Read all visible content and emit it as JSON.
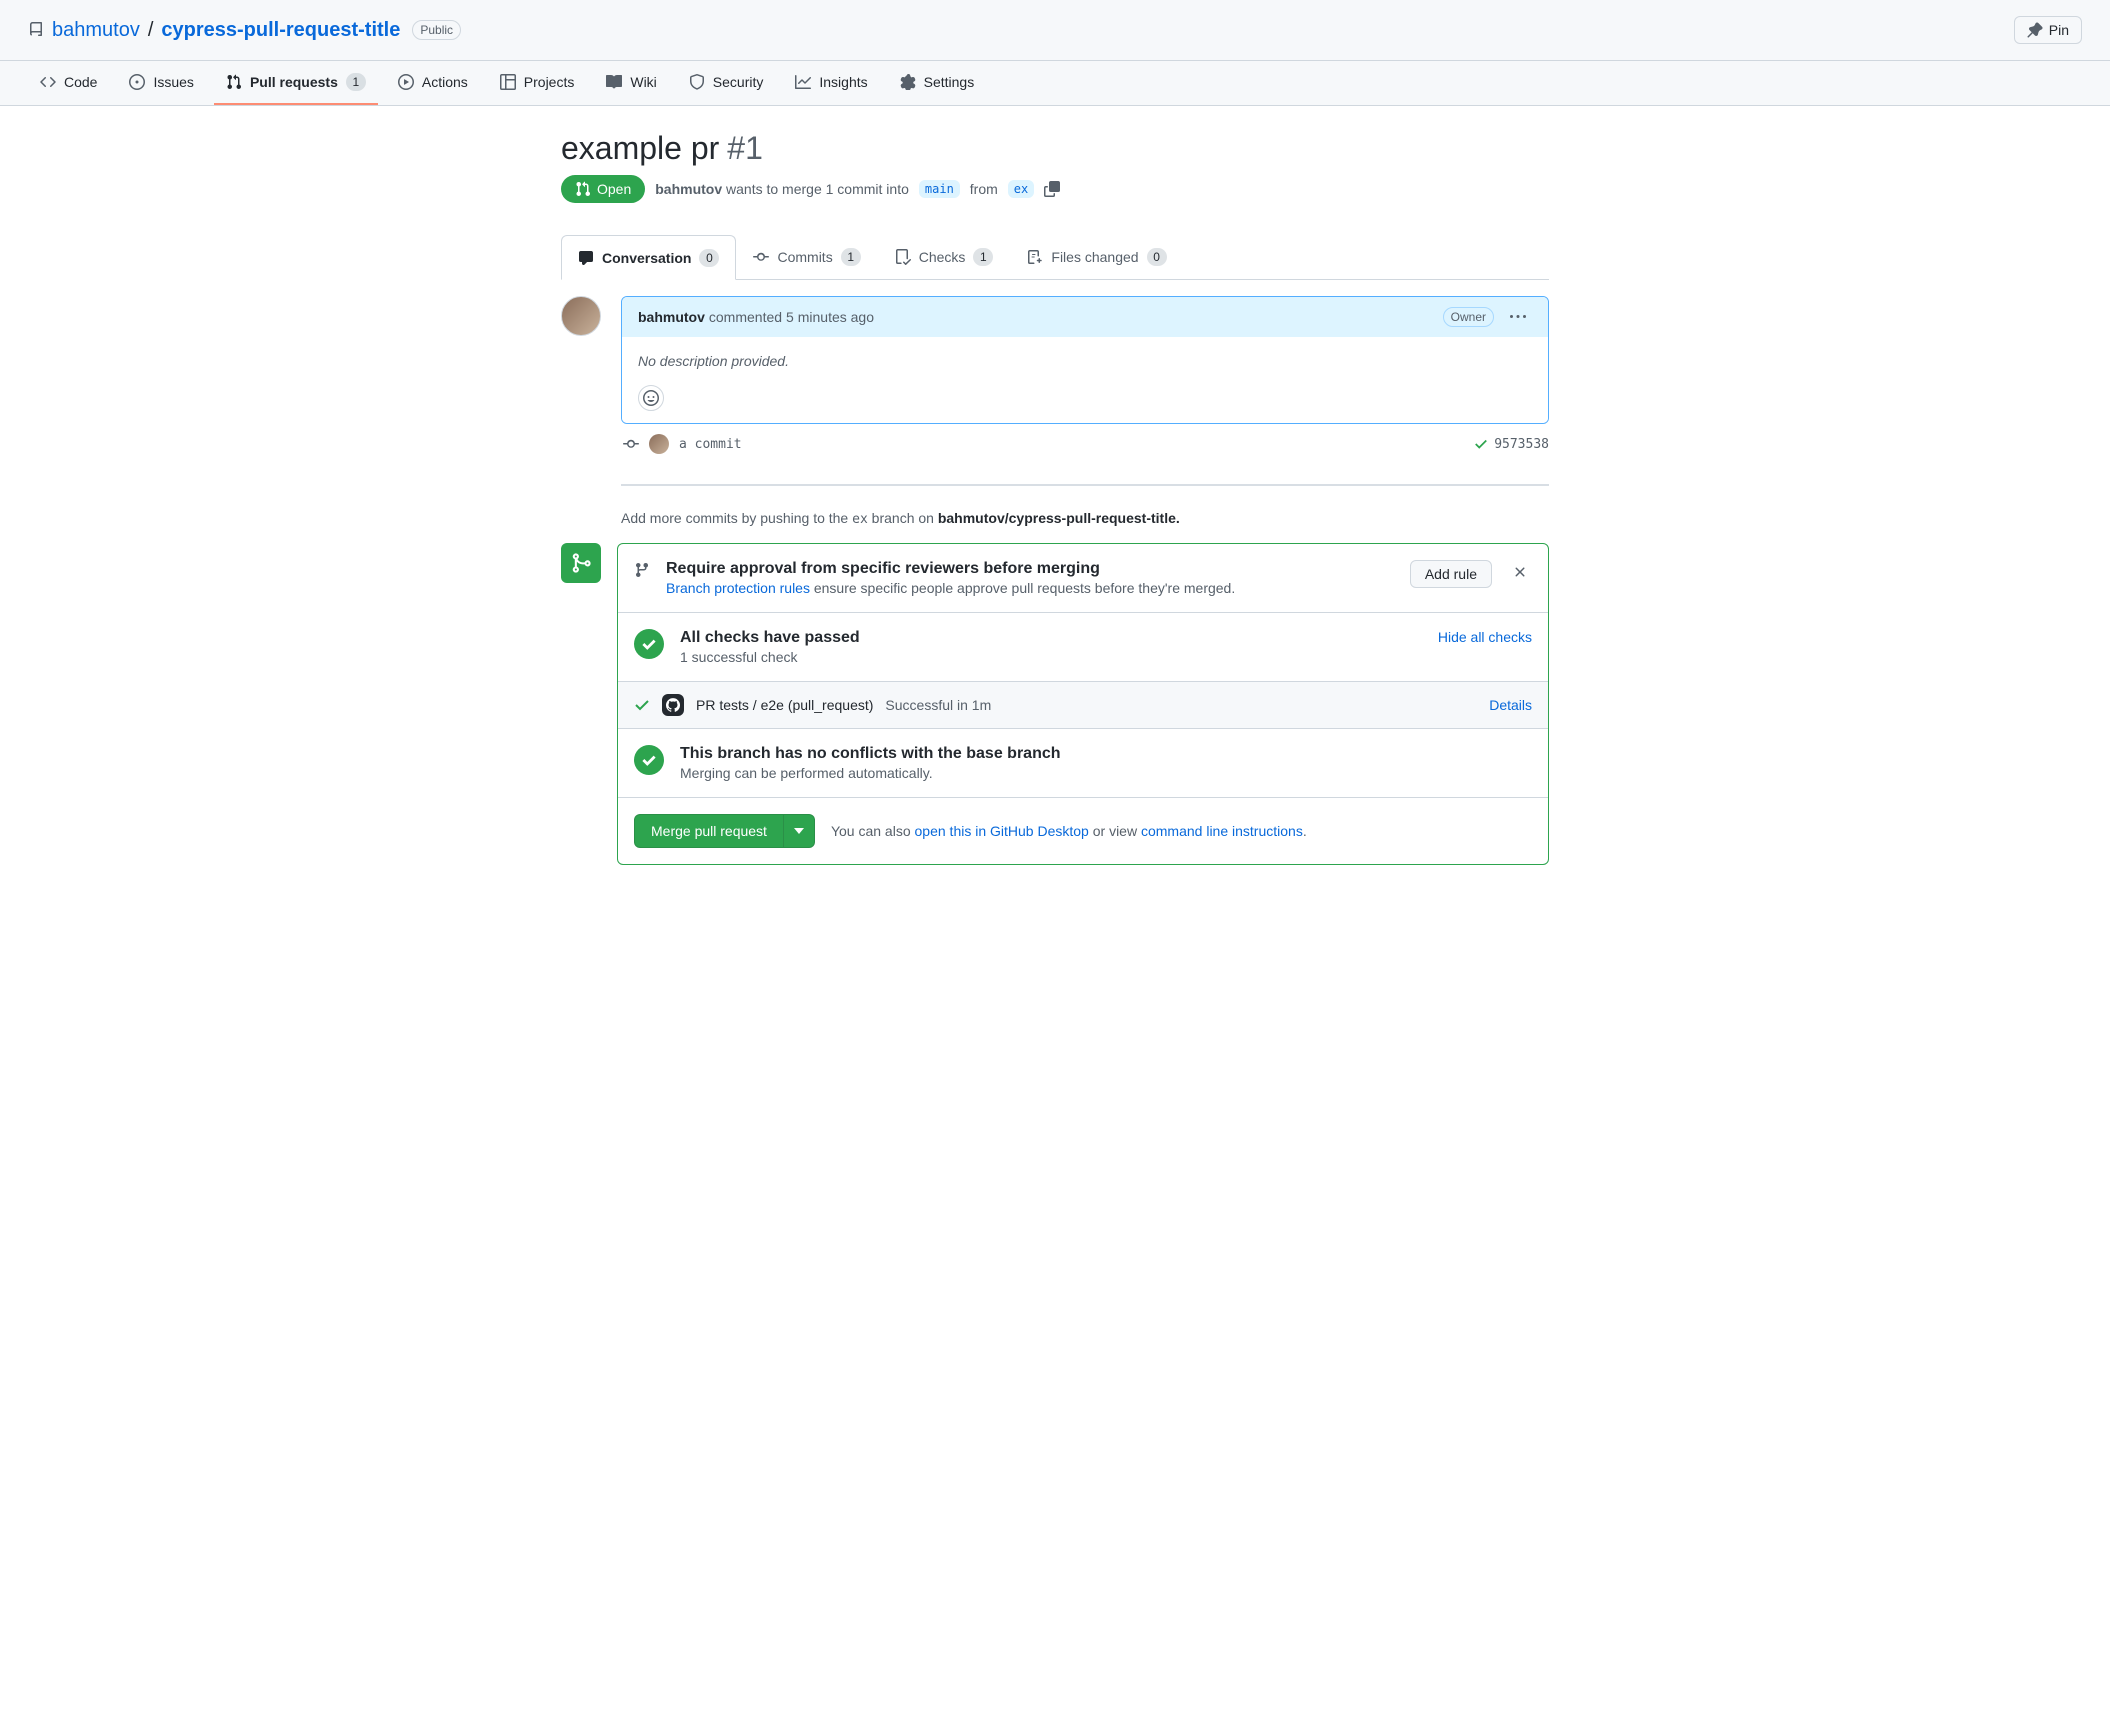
{
  "header": {
    "owner": "bahmutov",
    "repo": "cypress-pull-request-title",
    "visibility": "Public",
    "pin_label": "Pin"
  },
  "nav": {
    "code": "Code",
    "issues": "Issues",
    "pulls": "Pull requests",
    "pulls_count": "1",
    "actions": "Actions",
    "projects": "Projects",
    "wiki": "Wiki",
    "security": "Security",
    "insights": "Insights",
    "settings": "Settings"
  },
  "pr": {
    "title": "example pr",
    "number": "#1",
    "state": "Open",
    "author": "bahmutov",
    "merge_text_1": "wants to merge 1 commit into",
    "base_branch": "main",
    "merge_text_2": "from",
    "head_branch": "ex"
  },
  "tabs": {
    "conversation": "Conversation",
    "conversation_count": "0",
    "commits": "Commits",
    "commits_count": "1",
    "checks": "Checks",
    "checks_count": "1",
    "files": "Files changed",
    "files_count": "0"
  },
  "comment": {
    "author": "bahmutov",
    "action": "commented",
    "time": "5 minutes ago",
    "badge": "Owner",
    "body": "No description provided."
  },
  "commit": {
    "message": "a commit",
    "sha": "9573538"
  },
  "push_hint": {
    "prefix": "Add more commits by pushing to the",
    "branch": "ex",
    "mid": "branch on",
    "repo": "bahmutov/cypress-pull-request-title"
  },
  "protection": {
    "title": "Require approval from specific reviewers before merging",
    "link": "Branch protection rules",
    "rest": " ensure specific people approve pull requests before they're merged.",
    "add_rule": "Add rule"
  },
  "checks": {
    "title": "All checks have passed",
    "subtitle": "1 successful check",
    "hide": "Hide all checks",
    "item_name": "PR tests / e2e (pull_request)",
    "item_status": "Successful in 1m",
    "details": "Details"
  },
  "conflict": {
    "title": "This branch has no conflicts with the base branch",
    "subtitle": "Merging can be performed automatically."
  },
  "merge": {
    "button": "Merge pull request",
    "also_prefix": "You can also ",
    "desktop_link": "open this in GitHub Desktop",
    "also_mid": " or view ",
    "cli_link": "command line instructions",
    "period": "."
  }
}
